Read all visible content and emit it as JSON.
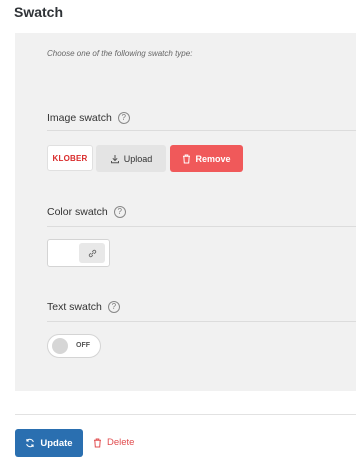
{
  "section": {
    "title": "Swatch"
  },
  "panel": {
    "hint": "Choose one of the following swatch type:",
    "image_swatch": {
      "label": "Image swatch",
      "logo_text": "KLOBER",
      "upload_label": "Upload",
      "remove_label": "Remove"
    },
    "color_swatch": {
      "label": "Color swatch"
    },
    "text_swatch": {
      "label": "Text swatch",
      "toggle_state": "OFF"
    }
  },
  "footer": {
    "update_label": "Update",
    "delete_label": "Delete"
  },
  "colors": {
    "primary": "#2a6fb0",
    "danger": "#f0595a",
    "danger_text": "#e14d4f",
    "panel_bg": "#f1f1f1"
  },
  "icons": {
    "help": "question-circle-icon",
    "upload": "upload-icon",
    "remove": "trash-icon",
    "link": "link-icon",
    "update": "refresh-icon",
    "delete": "trash-icon"
  }
}
